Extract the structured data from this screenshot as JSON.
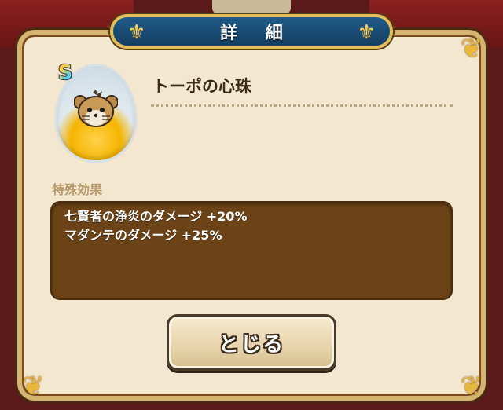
{
  "dialog": {
    "title": "詳 細",
    "close_label": "とじる"
  },
  "item": {
    "name": "トーポの心珠",
    "rank": "S",
    "icon": "topo-mouse-orb-icon"
  },
  "effect": {
    "label": "特殊効果",
    "lines": [
      "七賢者の浄炎のダメージ +20%",
      "マダンテのダメージ +25%"
    ]
  },
  "colors": {
    "banner": "#1f5b86",
    "frame_gold": "#d6b572",
    "panel_bg": "#f3e7cf",
    "effect_box": "#6b4316"
  }
}
